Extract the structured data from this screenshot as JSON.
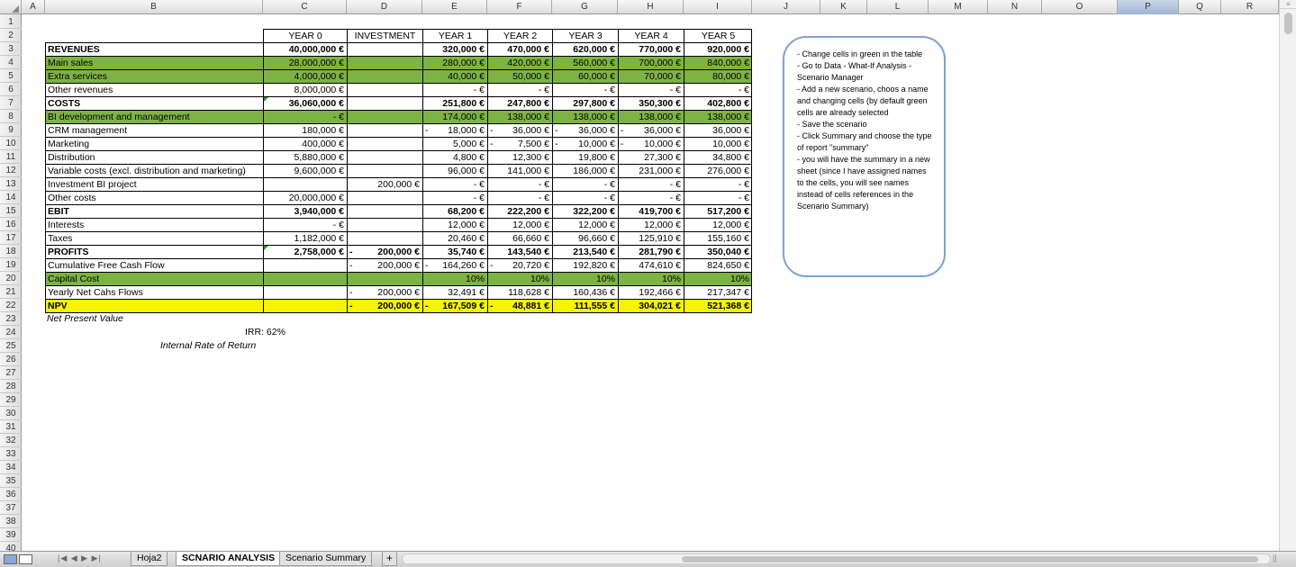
{
  "columns": [
    "A",
    "B",
    "C",
    "D",
    "E",
    "F",
    "G",
    "H",
    "I",
    "J",
    "K",
    "L",
    "M",
    "N",
    "O",
    "P",
    "Q",
    "R"
  ],
  "selected_column": "P",
  "rows": [
    "1",
    "2",
    "3",
    "4",
    "5",
    "6",
    "7",
    "8",
    "9",
    "10",
    "11",
    "12",
    "13",
    "14",
    "15",
    "16",
    "17",
    "18",
    "19",
    "20",
    "21",
    "22",
    "23",
    "24",
    "25",
    "26",
    "27",
    "28",
    "29",
    "30",
    "31",
    "32",
    "33",
    "34",
    "35",
    "36",
    "37",
    "38",
    "39",
    "40"
  ],
  "headers": [
    "YEAR 0",
    "INVESTMENT",
    "YEAR 1",
    "YEAR 2",
    "YEAR 3",
    "YEAR 4",
    "YEAR 5"
  ],
  "table": [
    {
      "label": "REVENUES",
      "style": "bold",
      "c": "40,000,000 €",
      "d": "",
      "e": "320,000 €",
      "f": "470,000 €",
      "g": "620,000 €",
      "h": "770,000 €",
      "i": "920,000 €"
    },
    {
      "label": "Main sales",
      "style": "green",
      "c": "28,000,000 €",
      "d": "",
      "e": "280,000 €",
      "f": "420,000 €",
      "g": "560,000 €",
      "h": "700,000 €",
      "i": "840,000 €"
    },
    {
      "label": "Extra services",
      "style": "green",
      "c": "4,000,000 €",
      "d": "",
      "e": "40,000 €",
      "f": "50,000 €",
      "g": "60,000 €",
      "h": "70,000 €",
      "i": "80,000 €"
    },
    {
      "label": "Other revenues",
      "style": "",
      "c": "8,000,000 €",
      "d": "",
      "e": "-   €",
      "f": "-   €",
      "g": "-   €",
      "h": "-   €",
      "i": "-   €"
    },
    {
      "label": "COSTS",
      "style": "bold",
      "c": "36,060,000 €",
      "d": "",
      "e": "251,800 €",
      "f": "247,800 €",
      "g": "297,800 €",
      "h": "350,300 €",
      "i": "402,800 €"
    },
    {
      "label": "BI development and management",
      "style": "green",
      "c": "-   €",
      "d": "",
      "e": "174,000 €",
      "f": "138,000 €",
      "g": "138,000 €",
      "h": "138,000 €",
      "i": "138,000 €"
    },
    {
      "label": "CRM management",
      "style": "",
      "c": "180,000 €",
      "d": "",
      "e": "18,000 €",
      "f": "36,000 €",
      "g": "36,000 €",
      "h": "36,000 €",
      "i": "36,000 €"
    },
    {
      "label": "Marketing",
      "style": "",
      "c": "400,000 €",
      "d": "",
      "e": "5,000 €",
      "f": "7,500 €",
      "g": "10,000 €",
      "h": "10,000 €",
      "i": "10,000 €"
    },
    {
      "label": "Distribution",
      "style": "",
      "c": "5,880,000 €",
      "d": "",
      "e": "4,800 €",
      "f": "12,300 €",
      "g": "19,800 €",
      "h": "27,300 €",
      "i": "34,800 €"
    },
    {
      "label": "Variable costs (excl. distribution and marketing)",
      "style": "",
      "c": "9,600,000 €",
      "d": "",
      "e": "96,000 €",
      "f": "141,000 €",
      "g": "186,000 €",
      "h": "231,000 €",
      "i": "276,000 €"
    },
    {
      "label": "Investment BI project",
      "style": "",
      "c": "",
      "d": "200,000 €",
      "e": "-   €",
      "f": "-   €",
      "g": "-   €",
      "h": "-   €",
      "i": "-   €"
    },
    {
      "label": "Other costs",
      "style": "",
      "c": "20,000,000 €",
      "d": "",
      "e": "-   €",
      "f": "-   €",
      "g": "-   €",
      "h": "-   €",
      "i": "-   €"
    },
    {
      "label": "EBIT",
      "style": "bold",
      "c": "3,940,000 €",
      "d": "",
      "e": "68,200 €",
      "f": "222,200 €",
      "g": "322,200 €",
      "h": "419,700 €",
      "i": "517,200 €"
    },
    {
      "label": "Interests",
      "style": "",
      "c": "-   €",
      "d": "",
      "e": "12,000 €",
      "f": "12,000 €",
      "g": "12,000 €",
      "h": "12,000 €",
      "i": "12,000 €"
    },
    {
      "label": "Taxes",
      "style": "",
      "c": "1,182,000 €",
      "d": "",
      "e": "20,460 €",
      "f": "66,660 €",
      "g": "96,660 €",
      "h": "125,910 €",
      "i": "155,160 €"
    },
    {
      "label": "PROFITS",
      "style": "bold",
      "c": "2,758,000 €",
      "d": "200,000 €",
      "e": "35,740 €",
      "f": "143,540 €",
      "g": "213,540 €",
      "h": "281,790 €",
      "i": "350,040 €"
    },
    {
      "label": "Cumulative Free Cash Flow",
      "style": "",
      "c": "",
      "d": "200,000 €",
      "e": "164,260 €",
      "f": "20,720 €",
      "g": "192,820 €",
      "h": "474,610 €",
      "i": "824,650 €"
    },
    {
      "label": "Capital Cost",
      "style": "green",
      "c": "",
      "d": "",
      "e": "10%",
      "f": "10%",
      "g": "10%",
      "h": "10%",
      "i": "10%"
    },
    {
      "label": "Yearly Net Cahs Flows",
      "style": "",
      "c": "",
      "d": "200,000 €",
      "e": "32,491 €",
      "f": "118,628 €",
      "g": "160,436 €",
      "h": "192,466 €",
      "i": "217,347 €"
    },
    {
      "label": "NPV",
      "style": "yellow",
      "c": "",
      "d": "200,000 €",
      "e": "167,509 €",
      "f": "48,881 €",
      "g": "111,555 €",
      "h": "304,021 €",
      "i": "521,368 €"
    }
  ],
  "npv_note": "Net Present Value",
  "irr_label": "IRR:",
  "irr_value": "62%",
  "irr_note": "Internal Rate of Return",
  "note_lines": [
    "- Change cells in green in the table",
    "- Go to Data - What-If Analysis - Scenario Manager",
    "- Add a new scenario, choos a name and changing cells (by default green cells are already selected",
    "- Save the scenario",
    "- Click Summary and choose the type of report \"summary\"",
    "- you will have the summary in a new sheet (since I have assigned names to the cells, you will see names instead of cells references in the Scenario Summary)"
  ],
  "dash": "-",
  "sheet_tabs": [
    "Hoja2",
    "SCNARIO ANALYSIS",
    "Scenario Summary"
  ],
  "active_tab": "SCNARIO ANALYSIS",
  "add_tab": "+",
  "nav_arrows": "|◀ ◀ ▶ ▶|",
  "colors": {
    "green": "#7db343",
    "yellow": "#f5f500",
    "note_border": "#7aa3cf"
  }
}
